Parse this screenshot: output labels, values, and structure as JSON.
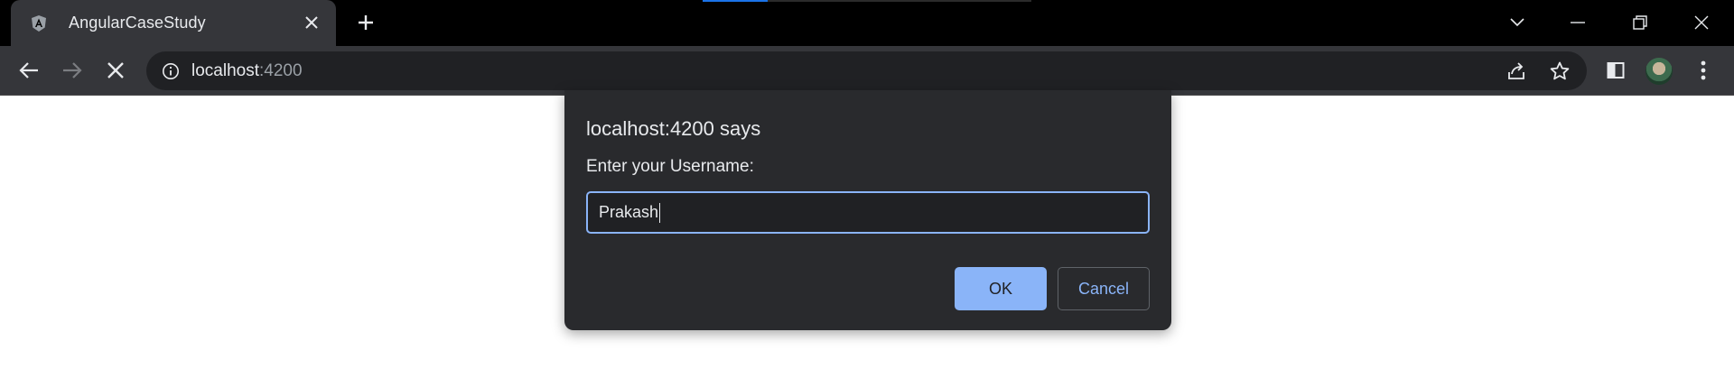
{
  "browser": {
    "tab": {
      "title": "AngularCaseStudy",
      "favicon": "angular-logo-icon"
    },
    "address": {
      "host": "localhost",
      "port": ":4200"
    }
  },
  "dialog": {
    "title": "localhost:4200 says",
    "message": "Enter your Username:",
    "input_value": "Prakash",
    "ok_label": "OK",
    "cancel_label": "Cancel"
  },
  "colors": {
    "accent": "#8ab4f8",
    "dialog_bg": "#292a2d",
    "toolbar_bg": "#35363a",
    "tabstrip_bg": "#000000"
  }
}
